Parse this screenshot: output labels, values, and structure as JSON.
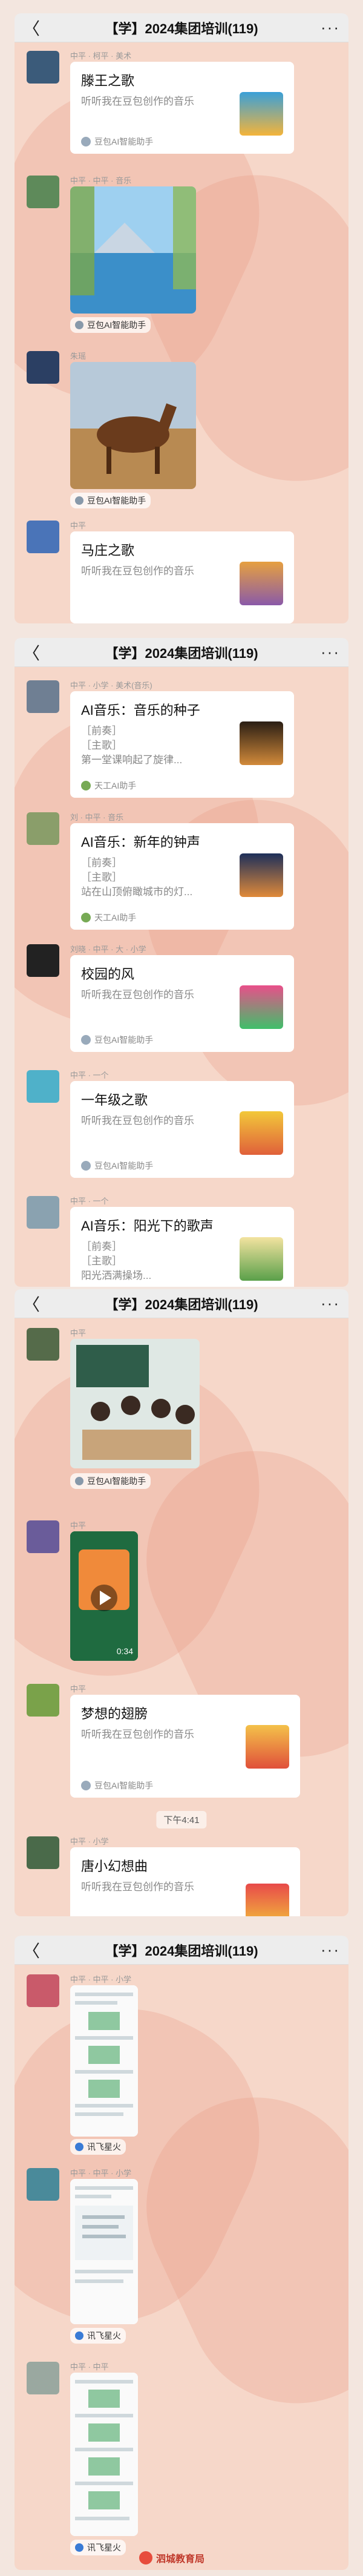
{
  "header": {
    "back": "〈",
    "title": "【学】2024集团培训(119)",
    "more": "···"
  },
  "names": {
    "n1": "中平 · 柯平 · 美术",
    "n2": "中平 · 中平 · 音乐",
    "n3": "朱瑶",
    "n4": "中平",
    "n5": "中平 · 小学 · 美术(音乐)",
    "n6": "刘 · 中平 · 音乐",
    "n7": "刘晓 · 中平 · 大 · 小学",
    "n8": "中平 · 一个",
    "n9": "中平 · 一个",
    "n10": "中平",
    "n11": "中平",
    "n12": "中平",
    "n13": "中平 · 小学",
    "n14": "中平 · 中平 · 小学",
    "n15": "中平 · 中平 · 小学",
    "n16": "中平 · 中平"
  },
  "cards": {
    "song1": {
      "title": "滕王之歌",
      "sub": "听听我在豆包创作的音乐",
      "src": "豆包AI智能助手"
    },
    "song2": {
      "title": "马庄之歌",
      "sub": "听听我在豆包创作的音乐"
    },
    "ai1": {
      "title": "AI音乐：音乐的种子",
      "l1": "［前奏］",
      "l2": "［主歌］",
      "l3": "第一堂课响起了旋律...",
      "src": "天工AI助手"
    },
    "ai2": {
      "title": "AI音乐：新年的钟声",
      "l1": "［前奏］",
      "l2": "［主歌］",
      "l3": "站在山顶俯瞰城市的灯...",
      "src": "天工AI助手"
    },
    "song3": {
      "title": "校园的风",
      "sub": "听听我在豆包创作的音乐",
      "src": "豆包AI智能助手"
    },
    "song4": {
      "title": "一年级之歌",
      "sub": "听听我在豆包创作的音乐",
      "src": "豆包AI智能助手"
    },
    "ai3": {
      "title": "AI音乐：阳光下的歌声",
      "l1": "［前奏］",
      "l2": "［主歌］",
      "l3": "阳光洒满操场..."
    },
    "song5": {
      "title": "梦想的翅膀",
      "sub": "听听我在豆包创作的音乐",
      "src": "豆包AI智能助手"
    },
    "song6": {
      "title": "唐小幻想曲",
      "sub": "听听我在豆包创作的音乐"
    }
  },
  "captions": {
    "cap1": "豆包AI智能助手",
    "cap2": "豆包AI智能助手",
    "cap3": "豆包AI智能助手",
    "cap4": "讯飞星火",
    "cap5": "讯飞星火",
    "cap6": "讯飞星火"
  },
  "video": {
    "duration": "0:34"
  },
  "time": "下午4:41",
  "watermark": "泗城教育局",
  "colors": {
    "panel": "#f6d7c9",
    "header": "#ededed"
  }
}
